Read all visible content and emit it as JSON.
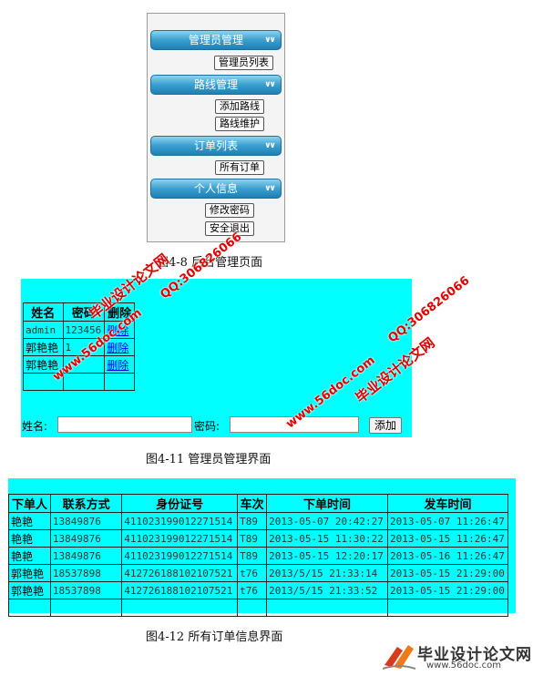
{
  "sidebar": {
    "sections": [
      {
        "title": "管理员管理",
        "buttons": [
          "管理员列表"
        ]
      },
      {
        "title": "路线管理",
        "buttons": [
          "添加路线",
          "路线维护"
        ]
      },
      {
        "title": "订单列表",
        "buttons": [
          "所有订单"
        ]
      },
      {
        "title": "个人信息",
        "buttons": [
          "修改密码",
          "安全退出"
        ]
      }
    ]
  },
  "captions": {
    "fig48": "图4-8 后台管理页面",
    "fig411": "图4-11   管理员管理界面",
    "fig412": "图4-12   所有订单信息界面"
  },
  "admin": {
    "headers": [
      "姓名",
      "密码",
      "删除"
    ],
    "rows": [
      [
        "admin",
        "123456",
        "删除"
      ],
      [
        "郭艳艳",
        "1",
        "删除"
      ],
      [
        "郭艳艳",
        "",
        "删除"
      ],
      [
        "",
        "",
        ""
      ]
    ],
    "form": {
      "name_label": "姓名:",
      "password_label": "密码:",
      "add_button": "添加"
    }
  },
  "orders": {
    "headers": [
      "下单人",
      "联系方式",
      "身份证号",
      "车次",
      "下单时间",
      "发车时间"
    ],
    "rows": [
      [
        "艳艳",
        "13849876",
        "411023199012271514",
        "T89",
        "2013-05-07 20:42:27",
        "2013-05-07 11:26:47"
      ],
      [
        "艳艳",
        "13849876",
        "411023199012271514",
        "T89",
        "2013-05-15 11:30:22",
        "2013-05-15 11:26:47"
      ],
      [
        "艳艳",
        "13849876",
        "411023199012271514",
        "T89",
        "2013-05-15 12:20:17",
        "2013-05-16 11:26:47"
      ],
      [
        "郭艳艳",
        "18537898",
        "412726188102107521",
        "t76",
        "2013/5/15 21:33:14",
        "2013-05-15 21:29:00"
      ],
      [
        "郭艳艳",
        "18537898",
        "412726188102107521",
        "t76",
        "2013/5/15 21:33:52",
        "2013-05-15 21:29:00"
      ],
      [
        "",
        "",
        "",
        "",
        "",
        ""
      ]
    ]
  },
  "watermarks": {
    "site_cn": "毕业设计论文网",
    "url": "www.56doc.com",
    "qq": "QQ:306826066",
    "logo_url": "www.56doc.com"
  }
}
